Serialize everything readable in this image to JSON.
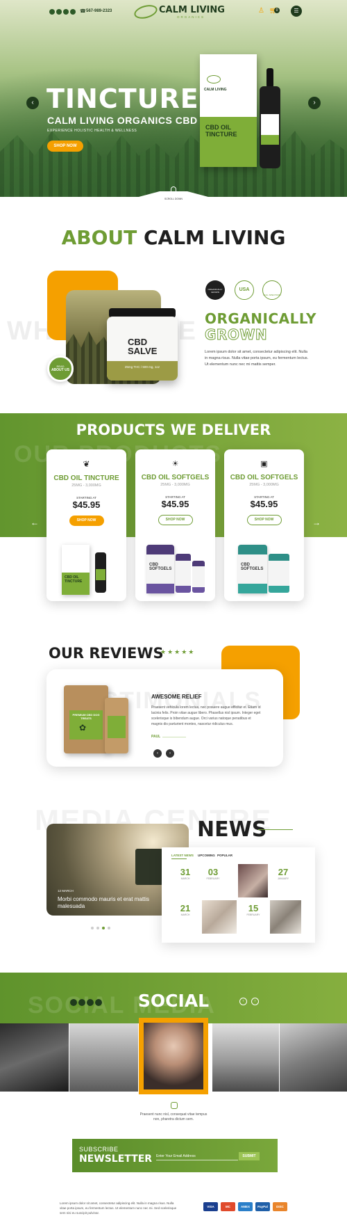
{
  "header": {
    "phone": "567-989-2323",
    "logo_title": "CALM LIVING",
    "logo_sub": "ORGANICS",
    "cart_count": "0"
  },
  "hero": {
    "title": "TINCTURE",
    "subtitle": "CALM LIVING ORGANICS CBD",
    "tagline": "EXPERIENCE HOLISTIC HEALTH & WELLNESS",
    "cta": "SHOP NOW",
    "scroll_label": "SCROLL DOWN",
    "box_brand": "CALM LIVING",
    "box_text": "CBD OIL TINCTURE"
  },
  "about": {
    "title_a": "ABOUT",
    "title_b": "CALM LIVING",
    "ghost": "WHO WE ARE",
    "badge_small": "READ",
    "badge_label": "ABOUT US",
    "salve_label": "CBD SALVE",
    "salve_dose": "25mg THC / 500 mg, 1oz",
    "badges": [
      "ORGANICALLY GROWN",
      "USA",
      "FULL SPECTRUM"
    ],
    "heading1": "ORGANICALLY",
    "heading2": "GROWN",
    "body": "Lorem ipsum dolor sit amet, consectetur adipiscing elit. Nulla in magna risus. Nulla vitae porta ipsum, eu fermentum lectus. Ut elementum nunc nec mi mattis semper."
  },
  "products": {
    "title": "PRODUCTS WE DELIVER",
    "ghost": "OUR PRODUCTS",
    "starting_label": "STARTING AT",
    "items": [
      {
        "name": "CBD OIL TINCTURE",
        "range": "25MG - 3,000MG",
        "price": "$45.95",
        "cta": "SHOP NOW"
      },
      {
        "name": "CBD OIL SOFTGELS",
        "range": "25MG - 3,000MG",
        "price": "$45.95",
        "cta": "SHOP NOW"
      },
      {
        "name": "CBD OIL SOFTGELS",
        "range": "25MG - 3,000MG",
        "price": "$45.95",
        "cta": "SHOP NOW"
      }
    ],
    "label_tincture": "CBD OIL TINCTURE",
    "label_softgels": "CBD SOFTGELS"
  },
  "reviews": {
    "title": "OUR REVIEWS",
    "ghost": "TESTIMONIALS",
    "stars": "★★★★★",
    "review_title": "AWESOME RELIEF",
    "review_text": "Praesent vehicula lorem lectus, nec posuere augue efficitur et. Etiam id lacinia felis. Proin vitae augue libero. Phasellus nisl ipsum. Integer eget scelerisque is bibendum augue. Orci varius natoque penatibus et magnis dis parturient montes, nascetur ridiculus mus.",
    "author": "PAUL",
    "pouch_text": "PREMIUM CBD DOG TREATS"
  },
  "news": {
    "title": "NEWS",
    "ghost": "MEDIA CENTRE",
    "feature_date": "12 MARCH",
    "feature_title": "Morbi commodo mauris et erat mattis malesuada",
    "tabs": [
      "LATEST NEWS",
      "UPCOMING",
      "POPULAR"
    ],
    "dates": [
      {
        "day": "31",
        "month": "MARCH"
      },
      {
        "day": "03",
        "month": "FEBRUARY"
      },
      {
        "day": "27",
        "month": "JANUARY"
      },
      {
        "day": "21",
        "month": "MARCH"
      },
      {
        "day": "15",
        "month": "FEBRUARY"
      }
    ]
  },
  "social": {
    "title": "SOCIAL",
    "ghost": "SOCIAL MEDIA",
    "caption": "Praesent nunc nisl, consequat vitae tempus non, pharetra dictum sem."
  },
  "newsletter": {
    "line1": "SUBSCRIBE",
    "line2": "NEWSLETTER",
    "placeholder": "Enter Your Email Address",
    "button": "SUBMIT"
  },
  "footer": {
    "text": "Lorem ipsum dolor sit amet, consectetur adipiscing elit. Nulla in magna risus. Nulla vitae porta ipsum, eu fermentum lectus. Ut elementum nunc nec mi. Sed scelerisque sem nisi eu suscipit pulvinar.",
    "payments": [
      "VISA",
      "MC",
      "AMEX",
      "PayPal",
      "DISC"
    ]
  },
  "colors": {
    "brand_green": "#6e9c34",
    "accent_orange": "#f5a000",
    "dark_green": "#1f3b1c"
  }
}
